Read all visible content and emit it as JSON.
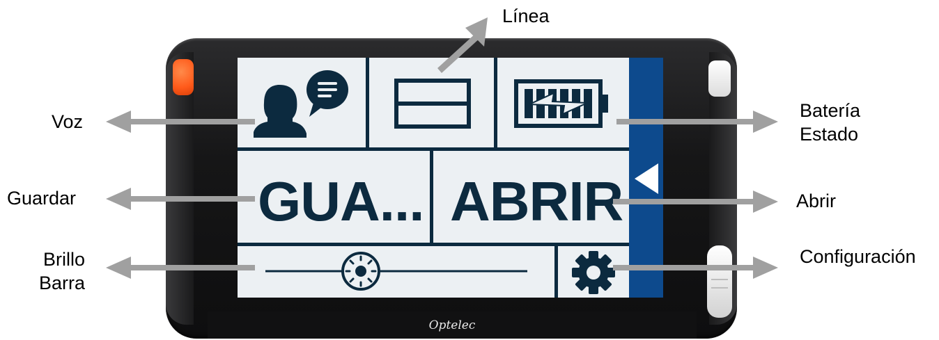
{
  "device": {
    "brand": "Optelec"
  },
  "screen": {
    "save_button_label": "GUA...",
    "open_button_label": "ABRIR"
  },
  "callouts": {
    "line": "Línea",
    "voice": "Voz",
    "battery": [
      "Batería",
      "Estado"
    ],
    "save": "Guardar",
    "open": "Abrir",
    "brightness": [
      "Brillo",
      "Barra"
    ],
    "settings": "Configuración"
  },
  "colors": {
    "screen_bg": "#ecf0f3",
    "ink": "#0c2a3f",
    "sidebar": "#0d4a8d",
    "arrow": "#a0a0a0",
    "orange_button": "#ff5a1a"
  },
  "icons": {
    "voice": "speaker-bubble-icon",
    "line": "line-mode-icon",
    "battery": "battery-charging-icon",
    "brightness": "brightness-sun-icon",
    "settings": "gear-icon",
    "collapse": "triangle-left-icon"
  }
}
